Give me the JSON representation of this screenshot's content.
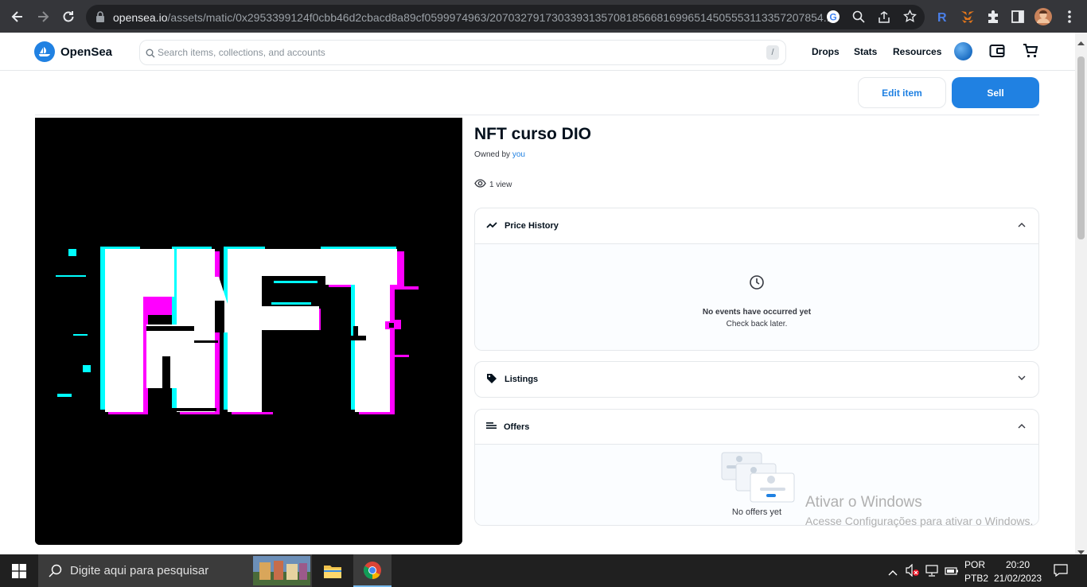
{
  "browser": {
    "url_host": "opensea.io",
    "url_path": "/assets/matic/0x2953399124f0cbb46d2cbacd8a89cf0599974963/207032791730339313570818566816996514505553113357207854..."
  },
  "header": {
    "logo_text": "OpenSea",
    "search_placeholder": "Search items, collections, and accounts",
    "search_shortcut": "/",
    "nav": [
      "Drops",
      "Stats",
      "Resources"
    ]
  },
  "actions": {
    "edit_label": "Edit item",
    "sell_label": "Sell"
  },
  "asset": {
    "title": "NFT curso DIO",
    "owned_prefix": "Owned by",
    "owner": "you",
    "views": "1 view"
  },
  "panels": {
    "price_history": {
      "title": "Price History",
      "empty_title": "No events have occurred yet",
      "empty_sub": "Check back later."
    },
    "listings": {
      "title": "Listings"
    },
    "offers": {
      "title": "Offers",
      "empty_title": "No offers yet"
    }
  },
  "watermark": {
    "line1": "Ativar o Windows",
    "line2": "Acesse Configurações para ativar o Windows."
  },
  "taskbar": {
    "search_text": "Digite aqui para pesquisar",
    "lang_top": "POR",
    "lang_bottom": "PTB2",
    "time": "20:20",
    "date": "21/02/2023"
  },
  "colors": {
    "accent": "#2081e2",
    "chrome_bg": "#35363a",
    "taskbar_bg": "#202020"
  }
}
